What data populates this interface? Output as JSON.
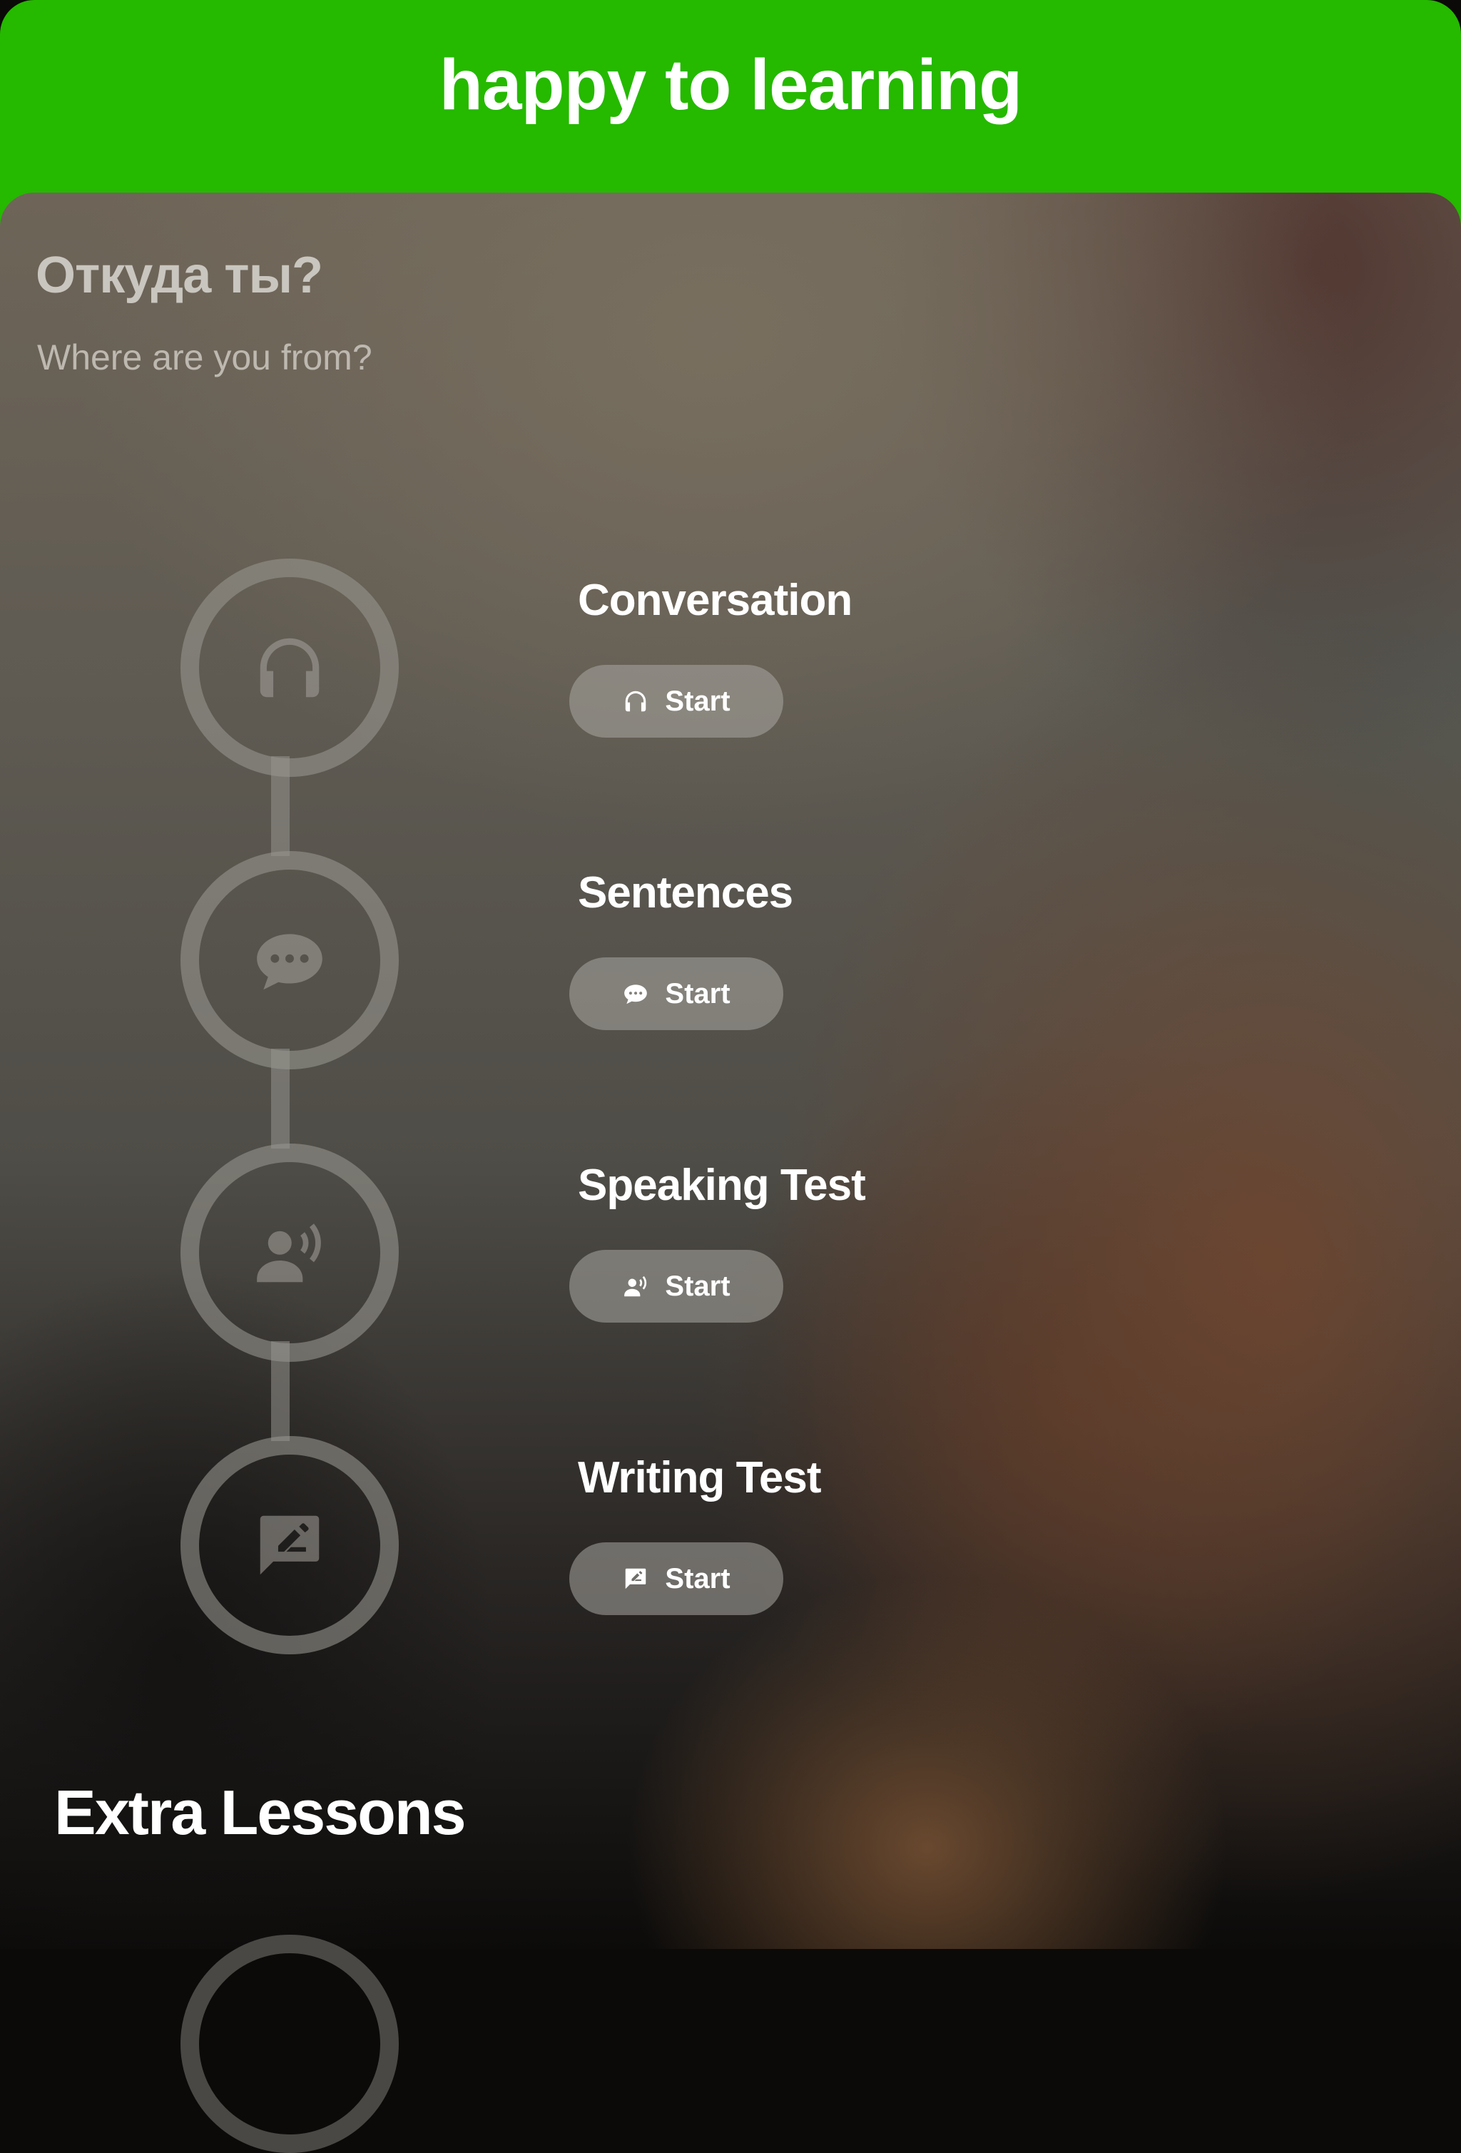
{
  "header": {
    "title": "happy to learning"
  },
  "lesson": {
    "title": "Откуда ты?",
    "subtitle": "Where are you from?"
  },
  "steps": [
    {
      "label": "Conversation",
      "icon": "headphones-icon",
      "button_label": "Start"
    },
    {
      "label": "Sentences",
      "icon": "chat-bubble-icon",
      "button_label": "Start"
    },
    {
      "label": "Speaking Test",
      "icon": "speaking-person-icon",
      "button_label": "Start"
    },
    {
      "label": "Writing Test",
      "icon": "edit-message-icon",
      "button_label": "Start"
    }
  ],
  "extra": {
    "title": "Extra Lessons"
  },
  "colors": {
    "header_bg": "#25b900",
    "text_primary": "#ffffff"
  }
}
